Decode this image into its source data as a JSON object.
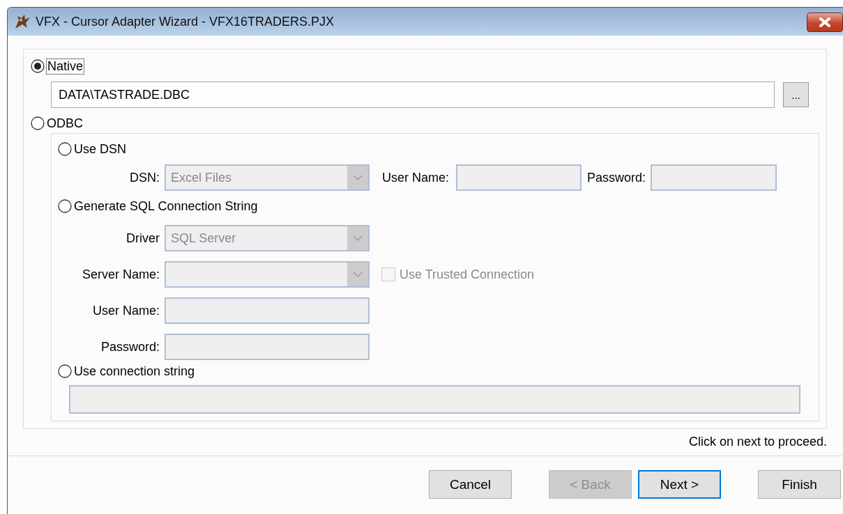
{
  "window": {
    "title": "VFX - Cursor Adapter Wizard - VFX16TRADERS.PJX"
  },
  "native": {
    "label": "Native",
    "selected": true,
    "focused": true,
    "path": "DATA\\TASTRADE.DBC",
    "browse": "..."
  },
  "odbc": {
    "label": "ODBC",
    "selected": false
  },
  "use_dsn": {
    "label": "Use DSN",
    "selected": false,
    "dsn_label": "DSN:",
    "dsn_value": "Excel Files",
    "user_label": "User Name:",
    "password_label": "Password:"
  },
  "generate_sql": {
    "label": "Generate SQL Connection String",
    "selected": false,
    "driver_label": "Driver",
    "driver_value": "SQL Server",
    "server_label": "Server Name:",
    "trusted": {
      "label": "Use Trusted Connection",
      "checked": false,
      "disabled": true
    },
    "user_label": "User Name:",
    "password_label": "Password:"
  },
  "connection_string": {
    "label": "Use connection string",
    "selected": false
  },
  "status": "Click on next to proceed.",
  "buttons": [
    {
      "label": "Cancel",
      "disabled": false,
      "default": false
    },
    {
      "label": "< Back",
      "disabled": true,
      "default": false
    },
    {
      "label": "Next >",
      "disabled": false,
      "default": true
    },
    {
      "label": "Finish",
      "disabled": false,
      "default": false
    }
  ]
}
